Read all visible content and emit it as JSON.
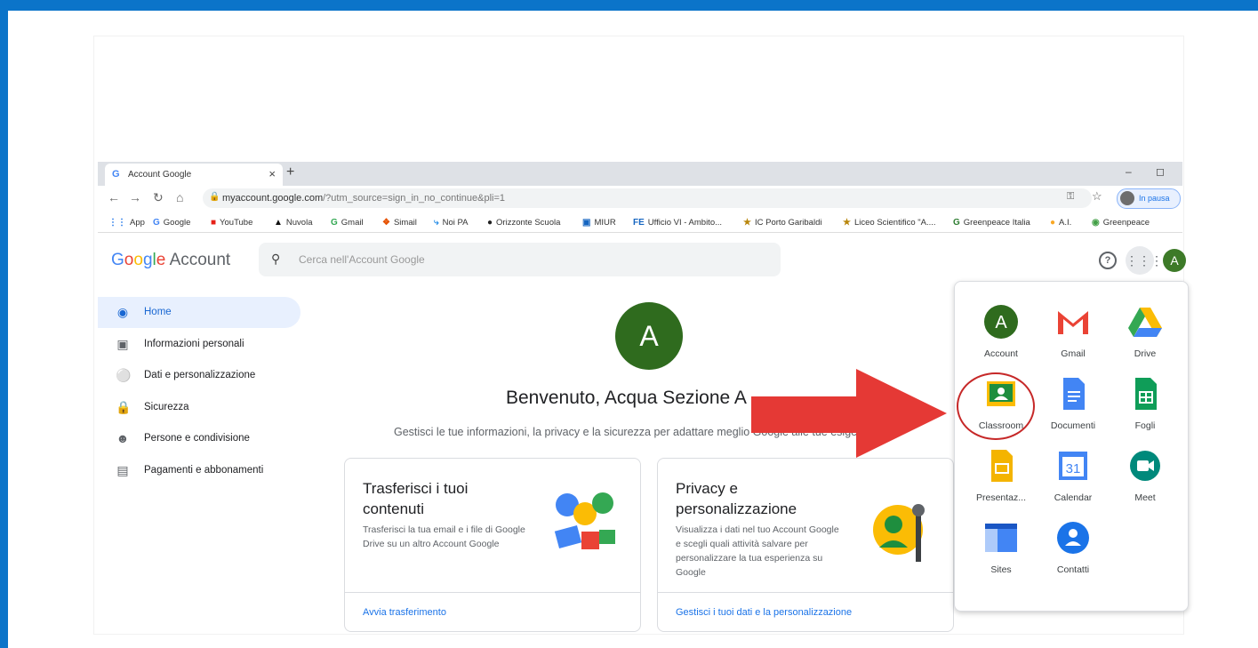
{
  "browser": {
    "tab_title": "Account Google",
    "tab_close": "×",
    "new_tab": "+",
    "address_host": "myaccount.google.com",
    "address_path": "/?utm_source=sign_in_no_continue&pli=1",
    "profile_status": "In pausa",
    "bookmarks": [
      "App",
      "Google",
      "YouTube",
      "Nuvola",
      "Gmail",
      "Simail",
      "Noi PA",
      "Orizzonte Scuola",
      "MIUR",
      "Ufficio VI - Ambito...",
      "IC Porto Garibaldi",
      "Liceo Scientifico \"A....",
      "Greenpeace Italia",
      "A.I.",
      "Greenpeace"
    ]
  },
  "header": {
    "logo_google": "Google",
    "logo_account": "Account",
    "search_placeholder": "Cerca nell'Account Google",
    "avatar_letter": "A"
  },
  "sidebar": {
    "items": [
      {
        "label": "Home"
      },
      {
        "label": "Informazioni personali"
      },
      {
        "label": "Dati e personalizzazione"
      },
      {
        "label": "Sicurezza"
      },
      {
        "label": "Persone e condivisione"
      },
      {
        "label": "Pagamenti e abbonamenti"
      }
    ]
  },
  "main": {
    "avatar_letter": "A",
    "welcome": "Benvenuto, Acqua Sezione A",
    "subtitle": "Gestisci le tue informazioni, la privacy e la sicurezza per adattare meglio Google alle tue esigenze",
    "cards": [
      {
        "title": "Trasferisci i tuoi contenuti",
        "desc": "Trasferisci la tua email e i file di Google Drive su un altro Account Google",
        "link": "Avvia trasferimento"
      },
      {
        "title": "Privacy e personalizzazione",
        "desc": "Visualizza i dati nel tuo Account Google e scegli quali attività salvare per personalizzare la tua esperienza su Google",
        "link": "Gestisci i tuoi dati e la personalizzazione"
      }
    ]
  },
  "apps_panel": {
    "apps": [
      {
        "label": "Account"
      },
      {
        "label": "Gmail"
      },
      {
        "label": "Drive"
      },
      {
        "label": "Classroom"
      },
      {
        "label": "Documenti"
      },
      {
        "label": "Fogli"
      },
      {
        "label": "Presentaz..."
      },
      {
        "label": "Calendar",
        "day": "31"
      },
      {
        "label": "Meet"
      },
      {
        "label": "Sites"
      },
      {
        "label": "Contatti"
      }
    ]
  },
  "colors": {
    "background_border": "#0b74c9",
    "highlight_red": "#d32f2f",
    "link_blue": "#1a73e8"
  }
}
